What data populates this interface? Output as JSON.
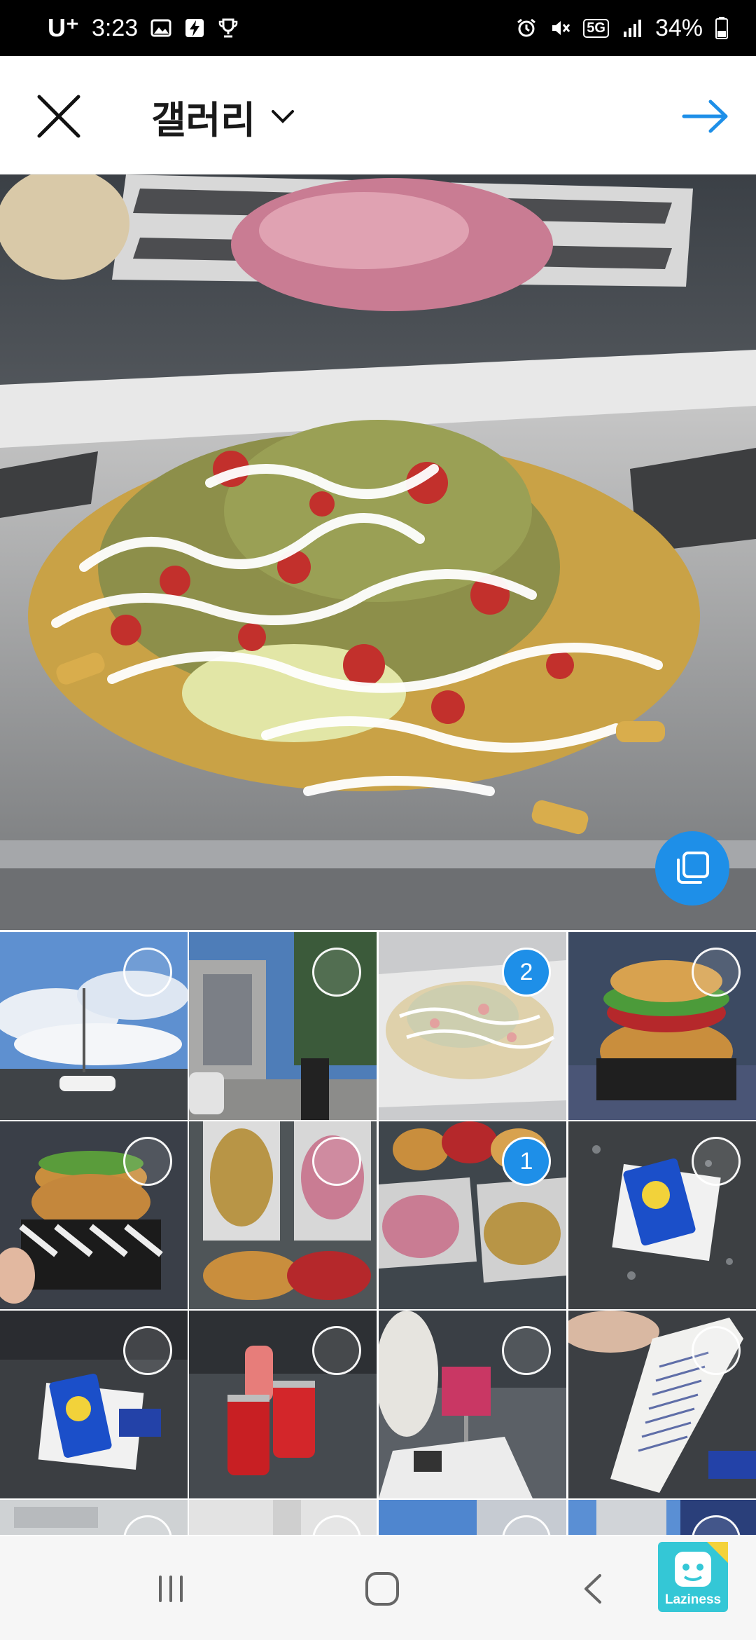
{
  "status_bar": {
    "carrier": "U⁺",
    "time": "3:23",
    "network": "5G",
    "battery": "34%"
  },
  "header": {
    "title": "갤러리"
  },
  "grid": {
    "selected": [
      {
        "order": "2"
      },
      {
        "order": "1"
      }
    ]
  },
  "watermark": {
    "label": "Laziness"
  },
  "colors": {
    "accent": "#1e8fe8",
    "statusbar_bg": "#000000"
  },
  "icons": [
    "close-icon",
    "chevron-down-icon",
    "arrow-right-icon",
    "multi-select-icon",
    "recents-icon",
    "home-icon",
    "back-icon"
  ]
}
